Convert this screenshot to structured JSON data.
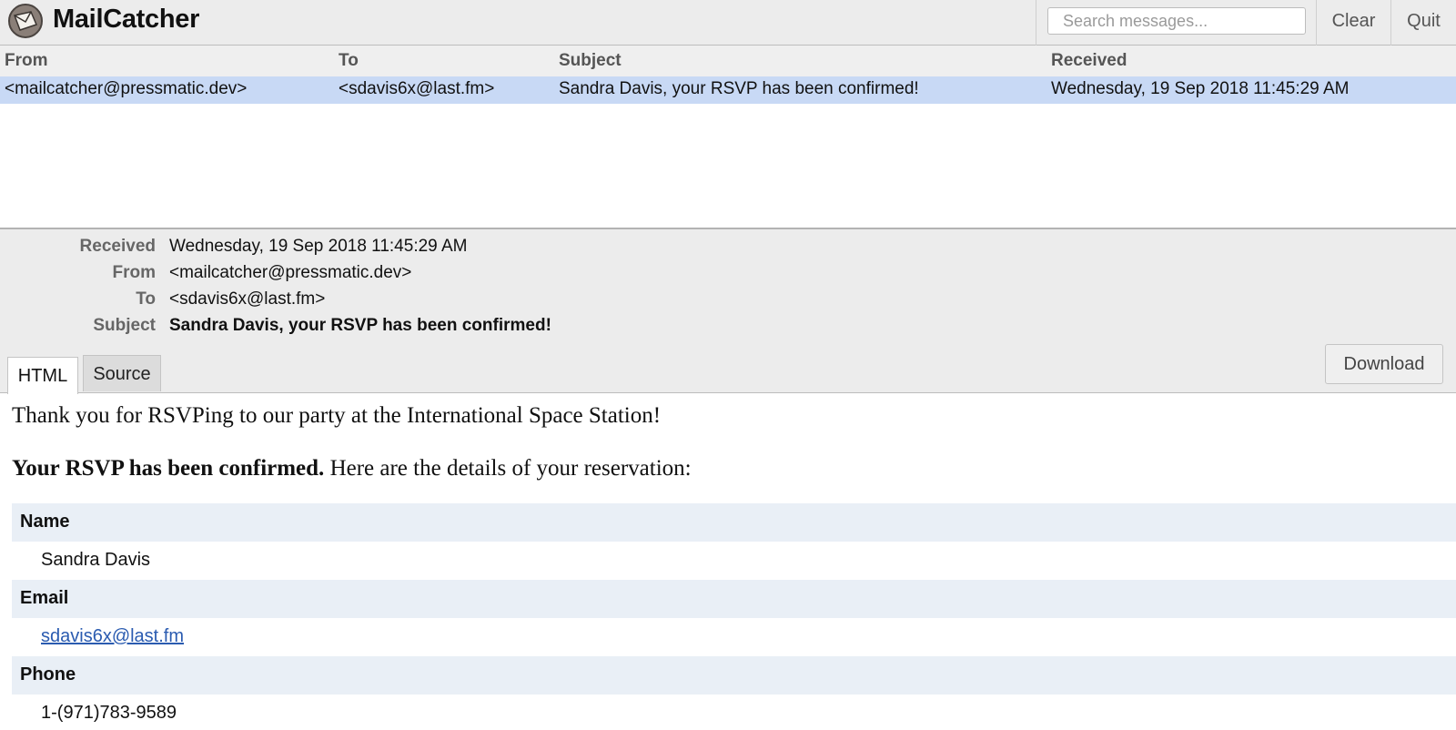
{
  "app": {
    "title": "MailCatcher"
  },
  "search": {
    "placeholder": "Search messages..."
  },
  "header_buttons": {
    "clear": "Clear",
    "quit": "Quit"
  },
  "list": {
    "columns": [
      "From",
      "To",
      "Subject",
      "Received"
    ],
    "rows": [
      {
        "from": "<mailcatcher@pressmatic.dev>",
        "to": "<sdavis6x@last.fm>",
        "subject": "Sandra Davis, your RSVP has been confirmed!",
        "received": "Wednesday, 19 Sep 2018 11:45:29 AM",
        "selected": true
      }
    ]
  },
  "message": {
    "labels": {
      "received": "Received",
      "from": "From",
      "to": "To",
      "subject": "Subject"
    },
    "received": "Wednesday, 19 Sep 2018 11:45:29 AM",
    "from": "<mailcatcher@pressmatic.dev>",
    "to": "<sdavis6x@last.fm>",
    "subject": "Sandra Davis, your RSVP has been confirmed!",
    "tabs": [
      "HTML",
      "Source"
    ],
    "active_tab": "HTML",
    "download_label": "Download"
  },
  "body": {
    "intro": "Thank you for RSVPing to our party at the International Space Station!",
    "confirm_bold": "Your RSVP has been confirmed.",
    "confirm_rest": " Here are the details of your reservation:",
    "details": [
      {
        "label": "Name",
        "value": "Sandra Davis"
      },
      {
        "label": "Email",
        "value": "sdavis6x@last.fm",
        "is_link": true
      },
      {
        "label": "Phone",
        "value": "1-(971)783-9589"
      }
    ]
  },
  "colors": {
    "header_bg": "#ececec",
    "selected_row": "#c8d9f5",
    "detail_label_bg": "#e9eff6",
    "link": "#2a5bb0"
  }
}
